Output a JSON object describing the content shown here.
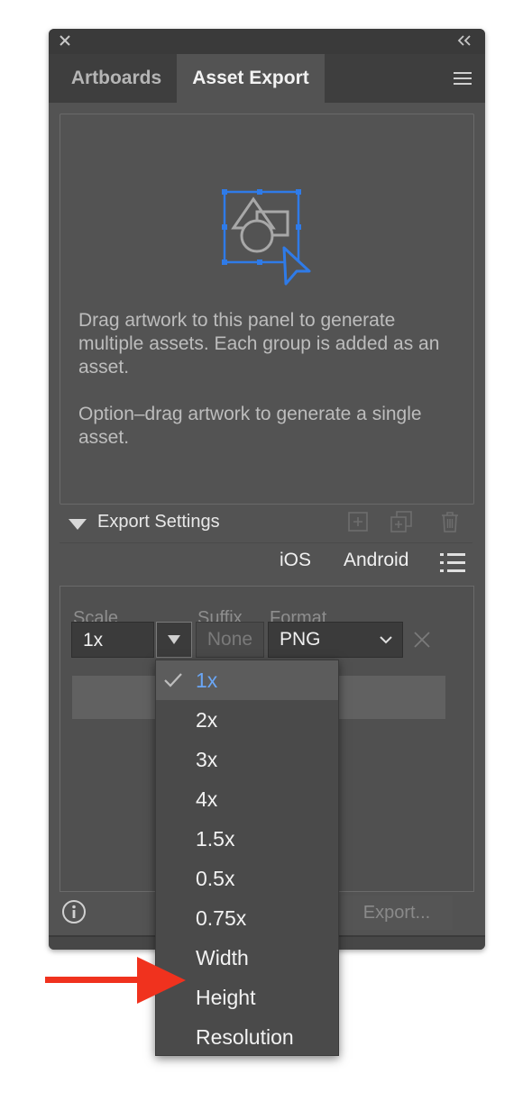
{
  "tabs": [
    {
      "label": "Artboards",
      "active": false
    },
    {
      "label": "Asset Export",
      "active": true
    }
  ],
  "dropzone": {
    "help_primary": "Drag artwork to this panel to generate multiple assets. Each group is added as an asset.",
    "help_secondary": "Option–drag artwork to generate a single asset."
  },
  "export_settings": {
    "header": "Export Settings",
    "ios": "iOS",
    "android": "Android",
    "columns": {
      "scale": "Scale",
      "suffix": "Suffix",
      "format": "Format"
    },
    "scale_value": "1x",
    "suffix_placeholder": "None",
    "format_value": "PNG",
    "export_button": "Export..."
  },
  "scale_menu": {
    "selected": "1x",
    "options": [
      "1x",
      "2x",
      "3x",
      "4x",
      "1.5x",
      "0.5x",
      "0.75x",
      "Width",
      "Height",
      "Resolution"
    ]
  },
  "colors": {
    "panel_bg": "#535353",
    "accent_blue": "#2f7be8",
    "selected_text": "#6aa6f5",
    "arrow_red": "#f0321e"
  },
  "icons": [
    "close-icon",
    "collapse-icon",
    "panel-menu-icon",
    "asset-illustration-icon",
    "disclosure-triangle-icon",
    "add-asset-icon",
    "duplicate-asset-icon",
    "trash-icon",
    "list-options-icon",
    "dropdown-arrow-icon",
    "chevron-down-icon",
    "remove-icon",
    "info-icon",
    "checkmark-icon",
    "red-arrow-icon"
  ]
}
